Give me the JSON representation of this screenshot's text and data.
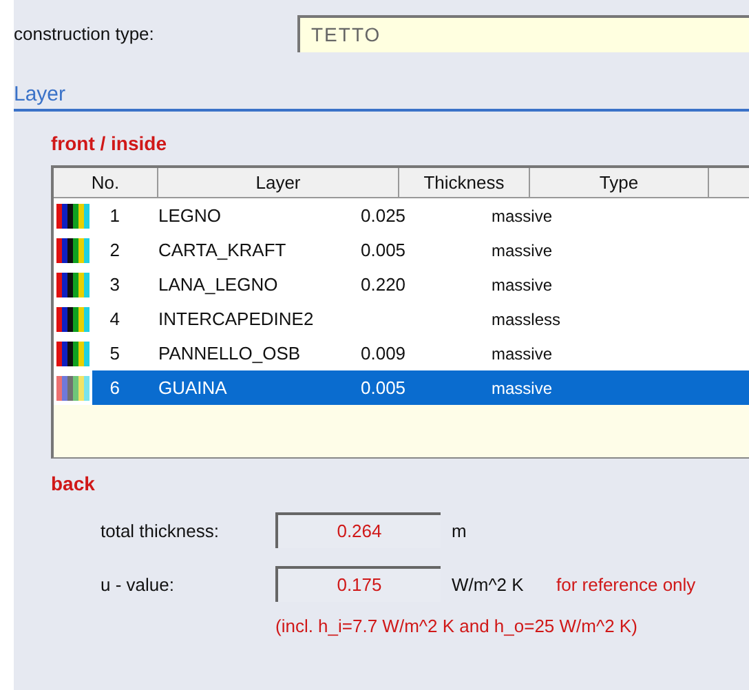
{
  "construction_type": {
    "label": "construction type:",
    "value": "TETTO"
  },
  "section_title": "Layer",
  "front_label": "front / inside",
  "table": {
    "columns": [
      "No.",
      "Layer",
      "Thickness",
      "Type"
    ],
    "rows": [
      {
        "no": "1",
        "layer": "LEGNO",
        "thickness": "0.025",
        "type": "massive",
        "selected": false
      },
      {
        "no": "2",
        "layer": "CARTA_KRAFT",
        "thickness": "0.005",
        "type": "massive",
        "selected": false
      },
      {
        "no": "3",
        "layer": "LANA_LEGNO",
        "thickness": "0.220",
        "type": "massive",
        "selected": false
      },
      {
        "no": "4",
        "layer": "INTERCAPEDINE2",
        "type": "massless",
        "selected": false
      },
      {
        "no": "5",
        "layer": "PANNELLO_OSB",
        "thickness": "0.009",
        "type": "massive",
        "selected": false
      },
      {
        "no": "6",
        "layer": "GUAINA",
        "thickness": "0.005",
        "type": "massive",
        "selected": true
      }
    ]
  },
  "back_label": "back",
  "total_thickness": {
    "label": "total thickness:",
    "value": "0.264",
    "unit": "m"
  },
  "u_value": {
    "label": "u - value:",
    "value": "0.175",
    "unit": "W/m^2 K",
    "note": "for reference only"
  },
  "footnote": "(incl. h_i=7.7 W/m^2 K and h_o=25 W/m^2 K)"
}
